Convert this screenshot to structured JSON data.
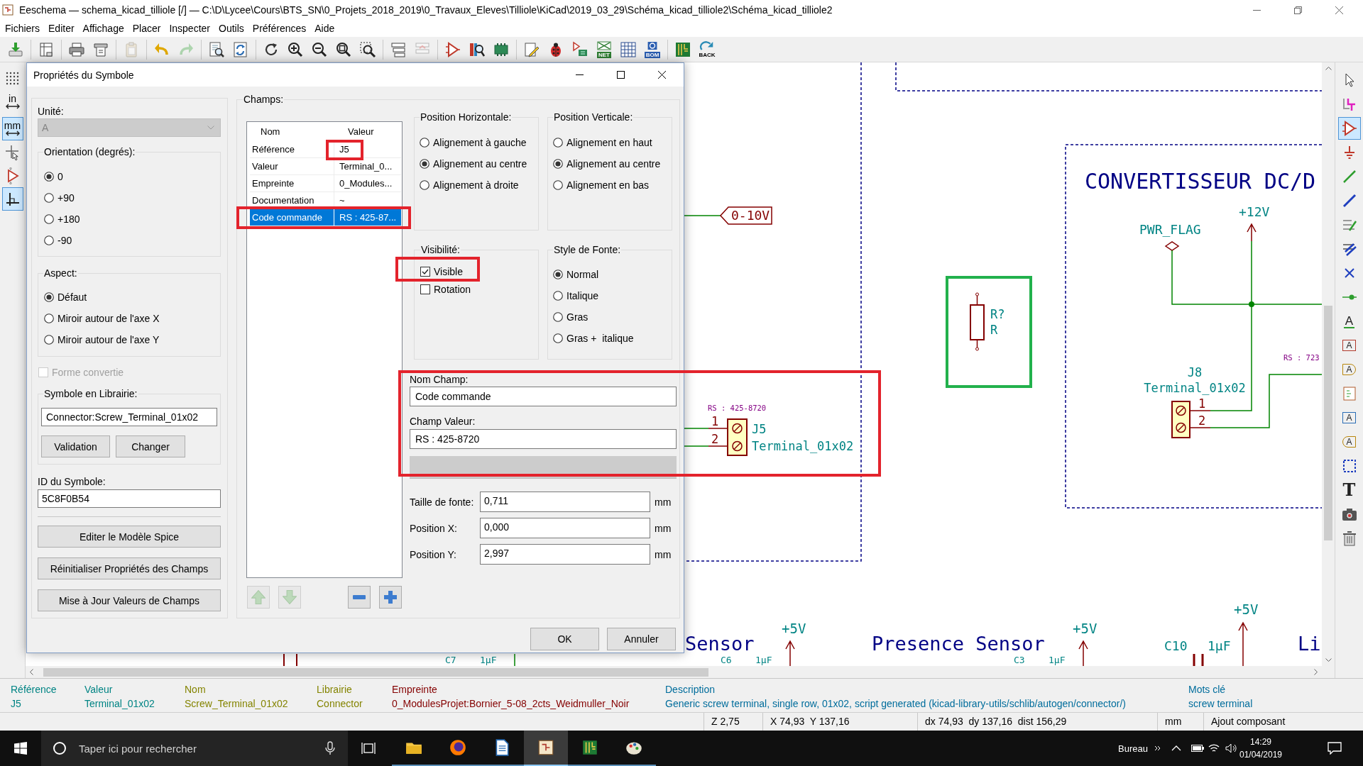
{
  "window": {
    "title": "Eeschema — schema_kicad_tilliole [/] — C:\\D\\Lycee\\Cours\\BTS_SN\\0_Projets_2018_2019\\0_Travaux_Eleves\\Tilliole\\KiCad\\2019_03_29\\Schéma_kicad_tilliole2\\Schéma_kicad_tilliole2"
  },
  "menu": [
    "Fichiers",
    "Editer",
    "Affichage",
    "Placer",
    "Inspecter",
    "Outils",
    "Préférences",
    "Aide"
  ],
  "toolbar": [
    {
      "disabled": false
    },
    {
      "disabled": false
    },
    {
      "disabled": false
    },
    {
      "disabled": false
    },
    {
      "disabled": true
    },
    {
      "disabled": false
    },
    {
      "disabled": true
    },
    {
      "disabled": false
    },
    {
      "disabled": false
    },
    {
      "disabled": false
    },
    {
      "disabled": false
    },
    {
      "disabled": false
    },
    {
      "disabled": false
    },
    {
      "disabled": false
    },
    {
      "disabled": false
    },
    {
      "disabled": true
    },
    {
      "disabled": false
    },
    {
      "disabled": false
    },
    {
      "disabled": false
    },
    {
      "disabled": false
    },
    {
      "disabled": false
    },
    {
      "disabled": false
    },
    {
      "label": "NET",
      "disabled": false
    },
    {
      "disabled": false
    },
    {
      "label": "BOM",
      "disabled": false
    },
    {
      "disabled": false
    },
    {
      "label": "BACK",
      "disabled": false
    }
  ],
  "left_toolbar": [
    {
      "selected": false
    },
    {
      "label": "in",
      "selected": false
    },
    {
      "label": "mm",
      "selected": true
    },
    {
      "selected": false
    },
    {
      "selected": false
    },
    {
      "selected": true
    }
  ],
  "right_toolbar": [
    {
      "selected": false
    },
    {
      "selected": false
    },
    {
      "selected": true
    },
    {
      "selected": false
    },
    {
      "selected": false
    },
    {
      "selected": false
    },
    {
      "selected": false
    },
    {
      "selected": false
    },
    {
      "selected": false
    },
    {
      "selected": false
    },
    {
      "glyph": "A",
      "selected": false
    },
    {
      "glyph": "A",
      "selected": false
    },
    {
      "glyph": "A",
      "selected": false
    },
    {
      "selected": false
    },
    {
      "glyph": "A",
      "selected": false
    },
    {
      "glyph": "A",
      "selected": false
    },
    {
      "selected": false
    },
    {
      "glyph": "T",
      "selected": false
    },
    {
      "selected": false
    },
    {
      "selected": false
    }
  ],
  "dialog": {
    "title": "Propriétés du Symbole",
    "unit": {
      "label": "Unité:",
      "value": "A",
      "disabled": true
    },
    "orientation": {
      "label": "Orientation (degrés):",
      "options": [
        {
          "label": "0",
          "selected": true
        },
        {
          "label": "+90",
          "selected": false
        },
        {
          "label": "+180",
          "selected": false
        },
        {
          "label": "-90",
          "selected": false
        }
      ]
    },
    "aspect": {
      "label": "Aspect:",
      "options": [
        {
          "label": "Défaut",
          "selected": true
        },
        {
          "label": "Miroir autour de l'axe X",
          "selected": false
        },
        {
          "label": "Miroir autour de l'axe Y",
          "selected": false
        }
      ]
    },
    "converted": {
      "label": "Forme convertie",
      "checked": false,
      "disabled": true
    },
    "library_symbol": {
      "label": "Symbole en Librairie:",
      "value": "Connector:Screw_Terminal_01x02",
      "buttons": [
        "Validation",
        "Changer"
      ]
    },
    "symbol_id": {
      "label": "ID du Symbole:",
      "value": "5C8F0B54"
    },
    "actions": [
      "Editer le Modèle Spice",
      "Réinitialiser Propriétés des Champs",
      "Mise à Jour Valeurs de Champs"
    ],
    "fields": {
      "label": "Champs:",
      "columns": [
        "Nom",
        "Valeur"
      ],
      "rows": [
        {
          "name": "Référence",
          "value": "J5",
          "selected": false
        },
        {
          "name": "Valeur",
          "value": "Terminal_0...",
          "selected": false
        },
        {
          "name": "Empreinte",
          "value": "0_Modules...",
          "selected": false
        },
        {
          "name": "Documentation",
          "value": "~",
          "selected": false
        },
        {
          "name": "Code commande",
          "value": "RS : 425-87...",
          "selected": true
        }
      ],
      "buttons": [
        {
          "disabled": true
        },
        {
          "disabled": true
        },
        {
          "disabled": false
        },
        {
          "disabled": false
        }
      ]
    },
    "horizontal_position": {
      "label": "Position Horizontale:",
      "options": [
        {
          "label": "Alignement à gauche",
          "selected": false
        },
        {
          "label": "Alignement au centre",
          "selected": true
        },
        {
          "label": "Alignement à droite",
          "selected": false
        }
      ]
    },
    "vertical_position": {
      "label": "Position Verticale:",
      "options": [
        {
          "label": "Alignement en haut",
          "selected": false
        },
        {
          "label": "Alignement au centre",
          "selected": true
        },
        {
          "label": "Alignement en bas",
          "selected": false
        }
      ]
    },
    "visibility": {
      "label": "Visibilité:",
      "options": [
        {
          "label": "Visible",
          "checked": true
        },
        {
          "label": "Rotation",
          "checked": false
        }
      ]
    },
    "font_style": {
      "label": "Style de Fonte:",
      "options": [
        {
          "label": "Normal",
          "selected": true
        },
        {
          "label": "Italique",
          "selected": false
        },
        {
          "label": "Gras",
          "selected": false
        },
        {
          "label": "Gras +  italique",
          "selected": false
        }
      ]
    },
    "field_name": {
      "label": "Nom Champ:",
      "value": "Code commande"
    },
    "field_value": {
      "label": "Champ Valeur:",
      "value": "RS : 425-8720"
    },
    "measures": [
      {
        "label": "Taille de fonte:",
        "value": "0,711",
        "unit": "mm"
      },
      {
        "label": "Position X:",
        "value": "0,000",
        "unit": "mm"
      },
      {
        "label": "Position Y:",
        "value": "2,997",
        "unit": "mm"
      }
    ],
    "buttons": [
      "OK",
      "Annuler"
    ]
  },
  "schematic": {
    "global_label": "0-10V",
    "left_connector": {
      "field": "RS : 425-8720",
      "pins": [
        "1",
        "2"
      ],
      "reference": "J5",
      "value": "Terminal_01x02"
    },
    "resistor": {
      "reference": "R?",
      "value": "R"
    },
    "sheet": {
      "title": "CONVERTISSEUR DC/D",
      "power_flag": "PWR_FLAG",
      "power": "+12V",
      "field": "RS : 723",
      "connector": {
        "reference": "J8",
        "value": "Terminal_01x02",
        "pins": [
          "1",
          "2"
        ]
      }
    },
    "bottom": {
      "titles": [
        "Sensor",
        "Presence Sensor"
      ],
      "powers": [
        "+5V",
        "+5V",
        "+5V"
      ],
      "capacitors": [
        {
          "reference": "C7",
          "value": "1µF"
        },
        {
          "reference": "C6",
          "value": "1µF"
        },
        {
          "reference": "C3",
          "value": "1µF"
        },
        {
          "reference": "C10",
          "value": "1µF"
        }
      ],
      "edge_text": "Li"
    }
  },
  "info_panel": [
    {
      "label": "Référence",
      "value": "J5",
      "color": "#008484"
    },
    {
      "label": "Valeur",
      "value": "Terminal_01x02",
      "color": "#008484"
    },
    {
      "label": "Nom",
      "value": "Screw_Terminal_01x02",
      "color": "#848400"
    },
    {
      "label": "Librairie",
      "value": "Connector",
      "color": "#848400"
    },
    {
      "label": "Empreinte",
      "value": "0_ModulesProjet:Bornier_5-08_2cts_Weidmuller_Noir",
      "color": "#840000"
    },
    {
      "label": "Description",
      "value": "Generic screw terminal, single row, 01x02, script generated (kicad-library-utils/schlib/autogen/connector/)",
      "color": "#006d9c"
    },
    {
      "label": "Mots clé",
      "value": "screw terminal",
      "color": "#006d9c"
    }
  ],
  "status_bar": [
    "Z 2,75",
    "X 74,93  Y 137,16",
    "dx 74,93  dy 137,16  dist 156,29",
    "mm",
    "Ajout composant"
  ],
  "taskbar": {
    "search": {
      "placeholder": "Taper ici pour rechercher"
    },
    "apps": [
      {
        "selected": false
      },
      {
        "selected": false
      },
      {
        "selected": false
      },
      {
        "selected": true
      },
      {
        "selected": false
      },
      {
        "selected": false
      }
    ],
    "tray_label": "Bureau",
    "time": "14:29",
    "date": "01/04/2019"
  }
}
